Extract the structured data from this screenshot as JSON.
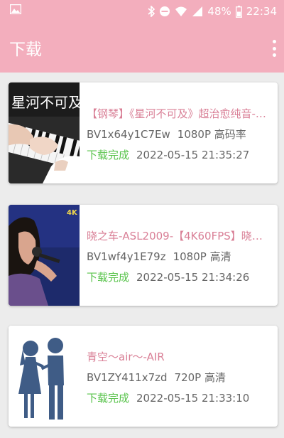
{
  "statusbar": {
    "battery": "48%",
    "time": "22:34"
  },
  "appbar": {
    "title": "下载"
  },
  "colors": {
    "accent": "#f3aebd",
    "title_pink": "#d97f96",
    "done_green": "#57c34a"
  },
  "downloads": [
    {
      "title": "【钢琴】《星河不可及》超治愈纯音-【…",
      "bvid": "BV1x64y1C7Ew",
      "quality": "1080P 高码率",
      "status": "下载完成",
      "time": "2022-05-15 21:35:27",
      "thumb_text": "星河不可及"
    },
    {
      "title": "晓之车-ASL2009-【4K60FPS】晓之车-…",
      "bvid": "BV1wf4y1E79z",
      "quality": "1080P 高清",
      "status": "下载完成",
      "time": "2022-05-15 21:34:26",
      "thumb_text": "4K"
    },
    {
      "title": "青空～air～-AIR",
      "bvid": "BV1ZY411x7zd",
      "quality": "720P 高清",
      "status": "下载完成",
      "time": "2022-05-15 21:33:10"
    }
  ]
}
